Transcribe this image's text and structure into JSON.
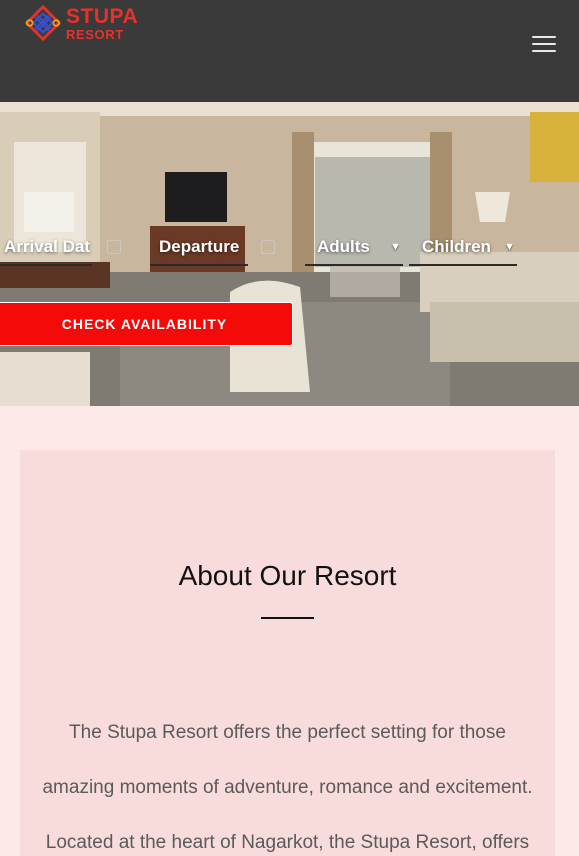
{
  "header": {
    "logo_line1": "STUPA",
    "logo_line2": "RESORT",
    "menu_icon": "hamburger-menu-icon",
    "bg_color": "#3a3a3a",
    "logo_color": "#e8312b"
  },
  "booking": {
    "arrival_placeholder": "Arrival Date",
    "arrival_display": "Arrival Dat",
    "departure_placeholder": "Departure",
    "adults_label": "Adults",
    "children_label": "Children",
    "calendar_icon": "calendar-icon",
    "dropdown_icon": "caret-down-icon",
    "check_button": "CHECK AVAILABILITY",
    "button_color": "#f50a0a"
  },
  "about": {
    "title": "About Our Resort",
    "lines": [
      "The Stupa Resort offers the perfect setting for those",
      "amazing moments of adventure, romance and excitement.",
      "Located at the heart of Nagarkot, the Stupa Resort, offers"
    ],
    "card_color": "#f8dcdc",
    "page_bg": "#fde9e8"
  }
}
